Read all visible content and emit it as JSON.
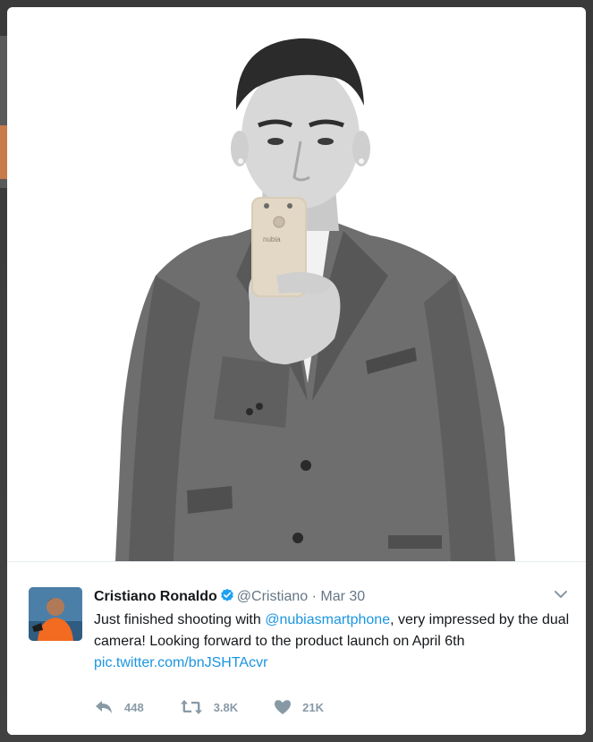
{
  "tweet": {
    "name": "Cristiano Ronaldo",
    "handle": "@Cristiano",
    "separator": "·",
    "date": "Mar 30",
    "text_part1": "Just finished shooting with ",
    "mention": "@nubiasmartphone",
    "text_part2": ", very impressed by the dual camera! Looking forward to the product launch on April 6th",
    "pic_link": "pic.twitter.com/bnJSHTAcvr"
  },
  "actions": {
    "reply_count": "448",
    "retweet_count": "3.8K",
    "like_count": "21K"
  },
  "icons": {
    "verified": "verified-badge-icon",
    "chevron": "chevron-down-icon",
    "reply": "reply-icon",
    "retweet": "retweet-icon",
    "like": "heart-icon"
  },
  "colors": {
    "link": "#1b95e0",
    "verified": "#1da1f2",
    "muted": "#657786",
    "action": "#8899a6"
  },
  "phone": {
    "brand": "nubia"
  }
}
